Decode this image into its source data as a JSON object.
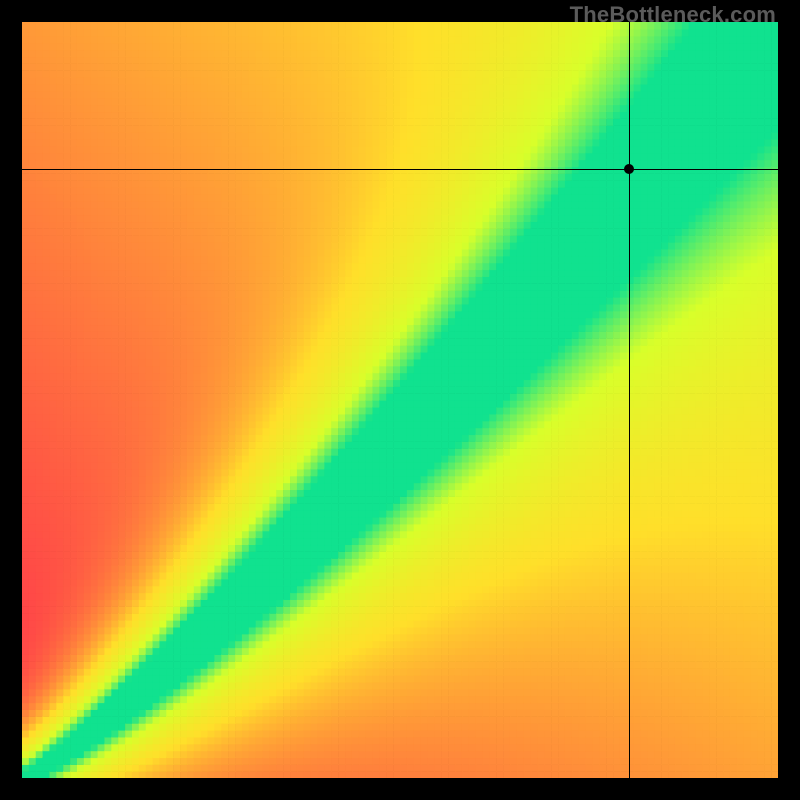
{
  "watermark": "TheBottleneck.com",
  "chart_data": {
    "type": "heatmap",
    "title": "",
    "xlabel": "",
    "ylabel": "",
    "xlim": [
      0,
      100
    ],
    "ylim": [
      0,
      100
    ],
    "grid": false,
    "legend": false,
    "description": "Bottleneck compatibility heatmap. Green diagonal band indicates balanced pairing; red indicates bottleneck. Crosshair marks the user's selected CPU/GPU point.",
    "color_stops": [
      {
        "value": 0.0,
        "color": "#ff2a4d"
      },
      {
        "value": 0.45,
        "color": "#ffdf2a"
      },
      {
        "value": 0.75,
        "color": "#d8ff2a"
      },
      {
        "value": 1.0,
        "color": "#10e28f"
      }
    ],
    "optimal_band": {
      "center_curve": "y = 100 * (x/100)^1.16",
      "halfwidth_at_0": 1,
      "halfwidth_at_100": 14
    },
    "resolution_cells": 110,
    "crosshair": {
      "x": 80.3,
      "y": 80.6
    },
    "series": []
  }
}
